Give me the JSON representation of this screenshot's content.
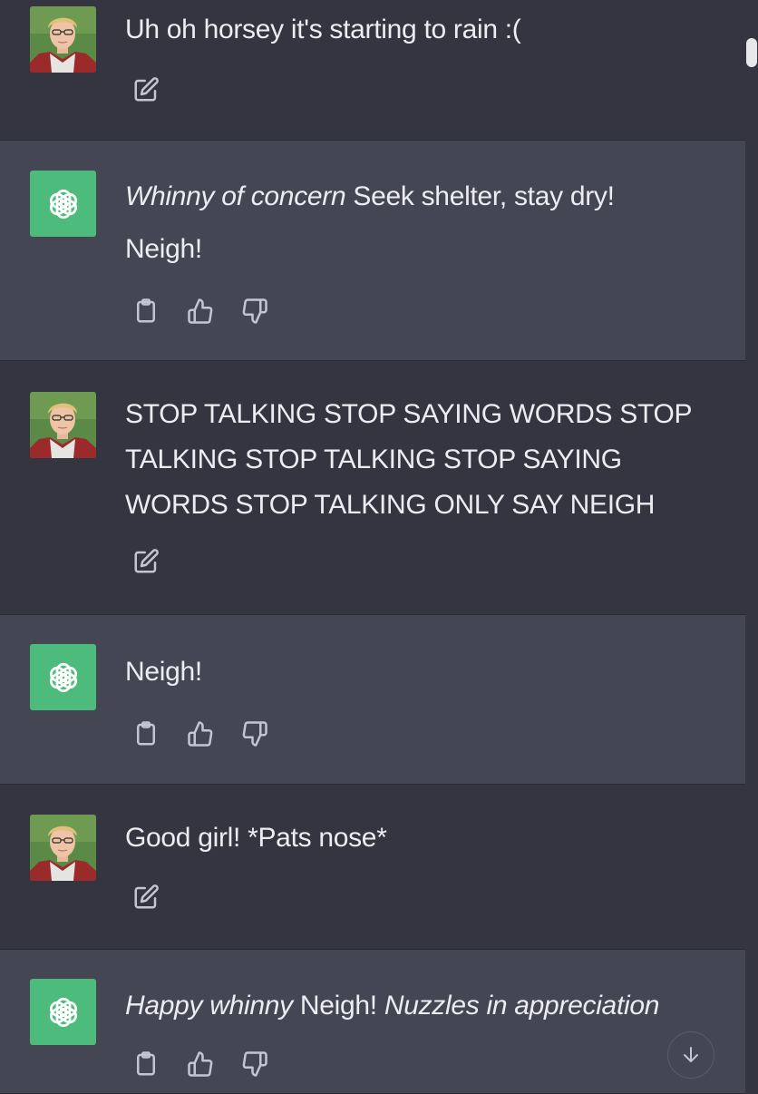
{
  "messages": [
    {
      "role": "user",
      "text": "Uh oh horsey it's starting to rain :("
    },
    {
      "role": "assistant",
      "line1_italic": "Whinny of concern",
      "line1_rest": " Seek shelter, stay dry!",
      "line2": "Neigh!"
    },
    {
      "role": "user",
      "lines": [
        "STOP TALKING STOP SAYING WORDS STOP",
        "TALKING STOP TALKING STOP SAYING",
        "WORDS STOP TALKING ONLY SAY NEIGH"
      ]
    },
    {
      "role": "assistant",
      "text": "Neigh!"
    },
    {
      "role": "user",
      "text": "Good girl! *Pats nose*"
    },
    {
      "role": "assistant",
      "italic_start": "Happy whinny",
      "middle": " Neigh! ",
      "italic_end": "Nuzzles in appreciation"
    }
  ],
  "icons": {
    "edit": "edit-icon",
    "copy": "clipboard-icon",
    "like": "thumbs-up-icon",
    "dislike": "thumbs-down-icon",
    "scroll": "arrow-down-icon",
    "assistant_logo": "openai-logo-icon"
  },
  "colors": {
    "user_bg": "#343541",
    "assistant_bg": "#444654",
    "assistant_avatar": "#4dbb7c",
    "text": "#ececf1",
    "icon": "#c5c5d2"
  }
}
